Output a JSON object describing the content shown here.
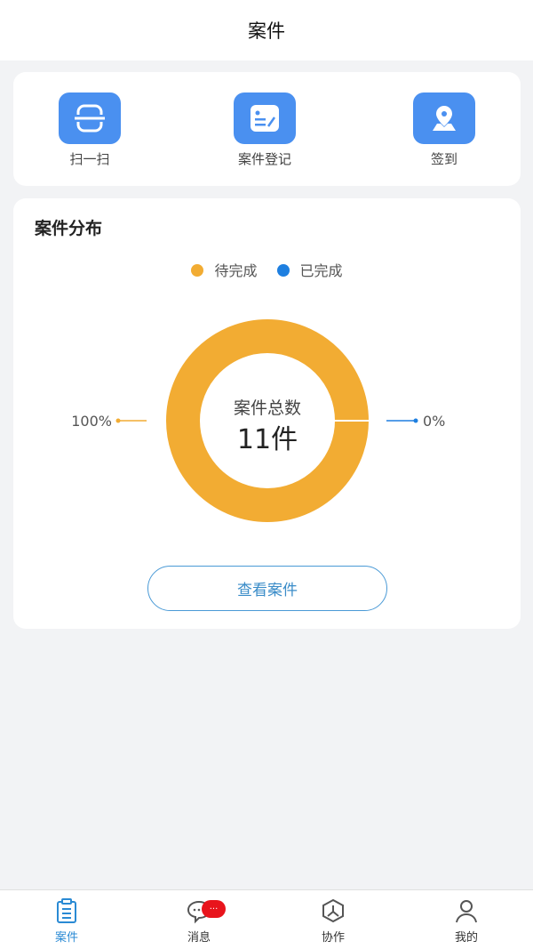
{
  "header": {
    "title": "案件"
  },
  "quick_actions": [
    {
      "label": "扫一扫",
      "icon": "scan-icon"
    },
    {
      "label": "案件登记",
      "icon": "register-icon"
    },
    {
      "label": "签到",
      "icon": "location-icon"
    }
  ],
  "distribution": {
    "title": "案件分布",
    "center_label": "案件总数",
    "center_value": "11件",
    "view_button": "查看案件",
    "chart_data": {
      "type": "pie",
      "donut": true,
      "legend_position": "top",
      "series": [
        {
          "name": "待完成",
          "value": 11,
          "percent_label": "100%",
          "color": "#f2ac33"
        },
        {
          "name": "已完成",
          "value": 0,
          "percent_label": "0%",
          "color": "#1e7fe0"
        }
      ]
    }
  },
  "tabbar": {
    "items": [
      {
        "label": "案件",
        "icon": "clipboard-icon",
        "active": true
      },
      {
        "label": "消息",
        "icon": "chat-icon",
        "badge": "..."
      },
      {
        "label": "协作",
        "icon": "collab-icon"
      },
      {
        "label": "我的",
        "icon": "user-icon"
      }
    ],
    "active_color": "#2a8ad4"
  }
}
